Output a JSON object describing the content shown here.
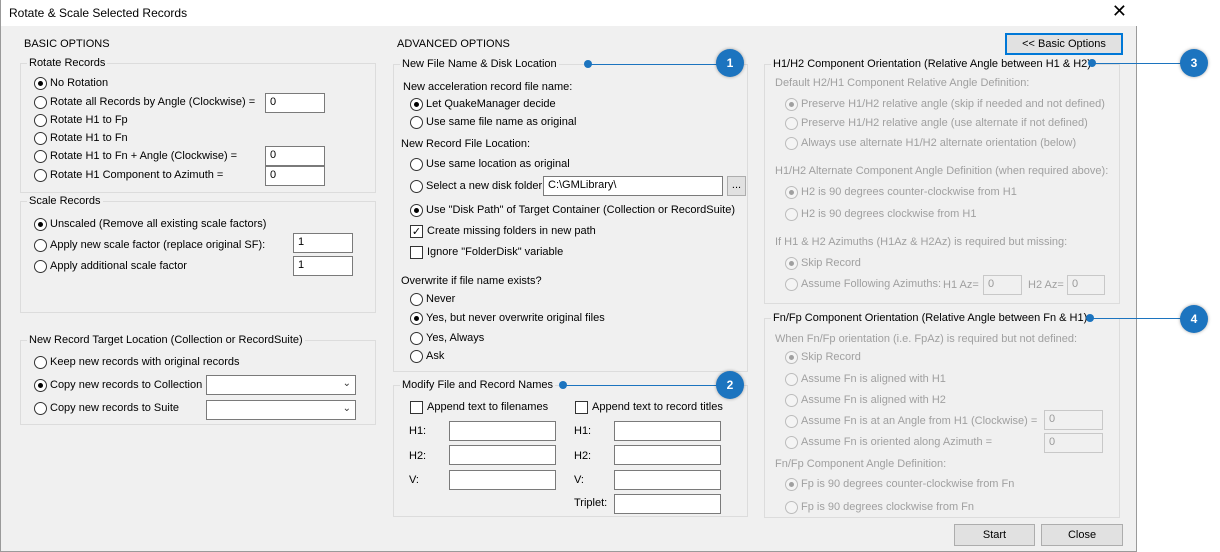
{
  "window": {
    "title": "Rotate & Scale Selected Records",
    "close_glyph": "✕"
  },
  "basic": {
    "header": "BASIC OPTIONS",
    "rotate": {
      "label": "Rotate Records",
      "options": [
        "No Rotation",
        "Rotate all Records by Angle (Clockwise) =",
        "Rotate H1 to Fp",
        "Rotate H1 to Fn",
        "Rotate H1 to Fn + Angle (Clockwise) =",
        "Rotate H1 Component to Azimuth ="
      ],
      "angle_value": "0",
      "fn_angle_value": "0",
      "azimuth_value": "0"
    },
    "scale": {
      "label": "Scale Records",
      "options": [
        "Unscaled (Remove all existing scale factors)",
        "Apply new scale factor (replace original SF):",
        "Apply additional scale factor"
      ],
      "new_sf_value": "1",
      "add_sf_value": "1"
    },
    "target": {
      "label": "New Record Target Location (Collection or RecordSuite)",
      "options": [
        "Keep new records with original records",
        "Copy new records to Collection",
        "Copy new records to Suite"
      ],
      "collection_value": "",
      "suite_value": ""
    }
  },
  "advanced": {
    "header": "ADVANCED OPTIONS",
    "basic_button": "<< Basic Options",
    "file": {
      "label": "New File Name & Disk Location",
      "name_prompt": "New acceleration record file name:",
      "name_options": [
        "Let QuakeManager decide",
        "Use same file name as original"
      ],
      "loc_prompt": "New Record File Location:",
      "loc_options": [
        "Use same location as original",
        "Select a new disk folder",
        "Use \"Disk Path\" of Target Container (Collection or RecordSuite)"
      ],
      "folder_value": "C:\\GMLibrary\\",
      "browse_label": "...",
      "create_folders": "Create missing folders in new path",
      "ignore_folder": "Ignore \"FolderDisk\" variable",
      "overwrite_prompt": "Overwrite if file name exists?",
      "overwrite_options": [
        "Never",
        "Yes, but never overwrite original files",
        "Yes, Always",
        "Ask"
      ]
    },
    "names": {
      "label": "Modify File and Record Names",
      "append_files": "Append text to filenames",
      "append_titles": "Append text to record titles",
      "h1": "H1:",
      "h2": "H2:",
      "v": "V:",
      "triplet": "Triplet:"
    },
    "h1h2": {
      "label": "H1/H2 Component Orientation (Relative Angle between H1 & H2)",
      "default_prompt": "Default H2/H1 Component Relative Angle Definition:",
      "default_options": [
        "Preserve H1/H2 relative angle (skip if needed and not defined)",
        "Preserve H1/H2 relative angle (use alternate if not defined)",
        "Always use alternate H1/H2 alternate orientation (below)"
      ],
      "alt_prompt": "H1/H2 Alternate Component Angle Definition (when required above):",
      "alt_options": [
        "H2 is 90 degrees counter-clockwise from H1",
        "H2 is 90 degrees clockwise from H1"
      ],
      "az_prompt": "If H1 & H2 Azimuths (H1Az & H2Az) is required but missing:",
      "az_options": [
        "Skip Record",
        "Assume Following Azimuths:"
      ],
      "h1az_label": "H1 Az=",
      "h1az_value": "0",
      "h2az_label": "H2 Az=",
      "h2az_value": "0"
    },
    "fnfp": {
      "label": "Fn/Fp Component Orientation (Relative Angle between Fn & H1)",
      "prompt": "When Fn/Fp orientation (i.e. FpAz) is required but not defined:",
      "options": [
        "Skip Record",
        "Assume Fn is aligned with H1",
        "Assume Fn is aligned with H2",
        "Assume Fn is at an Angle from H1 (Clockwise) =",
        "Assume Fn is oriented along Azimuth ="
      ],
      "angle_value": "0",
      "azimuth_value": "0",
      "def_prompt": "Fn/Fp Component Angle Definition:",
      "def_options": [
        "Fp is 90 degrees counter-clockwise from Fn",
        "Fp is 90 degrees clockwise from Fn"
      ]
    },
    "start_button": "Start",
    "close_button": "Close"
  },
  "callouts": [
    "1",
    "2",
    "3",
    "4"
  ],
  "colors": {
    "callout": "#1c74bf",
    "focus": "#0078d7",
    "disabled_text": "#a0a0a0"
  }
}
